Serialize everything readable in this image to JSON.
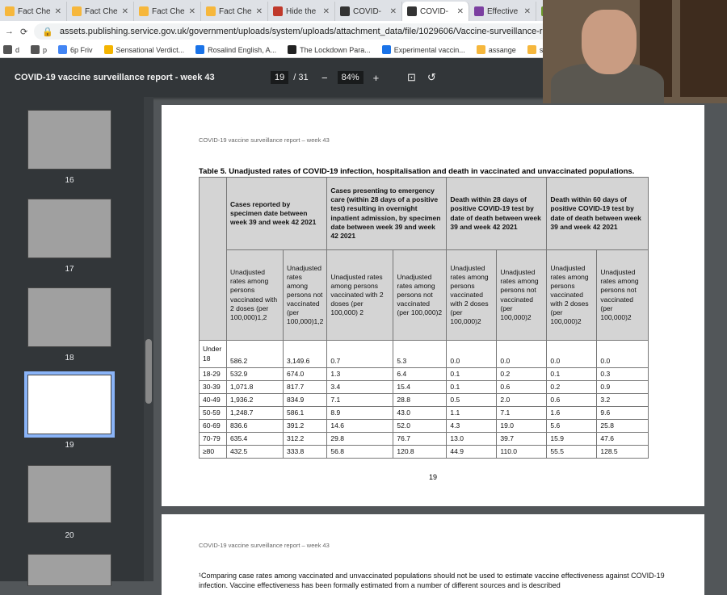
{
  "tabs": [
    {
      "label": "Fact Che",
      "color": "#f6b73c"
    },
    {
      "label": "Fact Che",
      "color": "#f6b73c"
    },
    {
      "label": "Fact Che",
      "color": "#f6b73c"
    },
    {
      "label": "Fact Che",
      "color": "#f6b73c"
    },
    {
      "label": "Hide the",
      "color": "#c0392b"
    },
    {
      "label": "COVID-",
      "color": "#333333"
    },
    {
      "label": "COVID-",
      "color": "#333333",
      "active": true
    },
    {
      "label": "Effective",
      "color": "#7b3fa0"
    },
    {
      "label": "CO",
      "color": "#6a9a2a"
    }
  ],
  "address": {
    "url": "assets.publishing.service.gov.uk/government/uploads/system/uploads/attachment_data/file/1029606/Vaccine-surveillance-repo..."
  },
  "bookmarks": [
    "d",
    "p",
    "6p Friv",
    "Sensational Verdict...",
    "Rosalind English, A...",
    "The Lockdown Para...",
    "Experimental vaccin...",
    "assange",
    "show wednesday"
  ],
  "viewer": {
    "title": "COVID-19 vaccine surveillance report - week 43",
    "page_current": "19",
    "page_total": "/ 31",
    "zoom": "84%"
  },
  "thumbnails": [
    {
      "number": "16"
    },
    {
      "number": "17"
    },
    {
      "number": "18"
    },
    {
      "number": "19",
      "selected": true
    },
    {
      "number": "20"
    }
  ],
  "page": {
    "running_head": "COVID-19 vaccine surveillance report – week 43",
    "caption": "Table 5. Unadjusted rates of COVID-19 infection, hospitalisation and death in vaccinated and unvaccinated populations.",
    "group_headers": [
      "Cases reported by specimen date between week 39 and week 42 2021",
      "Cases presenting to emergency care (within 28 days of a positive test) resulting in overnight inpatient admission, by specimen date between week 39 and week 42 2021",
      "Death within 28 days of positive COVID-19 test by date of death between week 39 and week 42 2021",
      "Death within 60 days of positive COVID-19 test by date of death between week 39 and week 42 2021"
    ],
    "sub_headers": [
      "Unadjusted rates among persons vaccinated with 2 doses (per 100,000)1,2",
      "Unadjusted rates among persons not vaccinated (per 100,000)1,2",
      "Unadjusted rates among persons vaccinated with 2 doses (per 100,000) 2",
      "Unadjusted rates among persons not vaccinated (per 100,000)2",
      "Unadjusted rates among persons vaccinated with 2 doses (per 100,000)2",
      "Unadjusted rates among persons not vaccinated (per 100,000)2",
      "Unadjusted rates among persons vaccinated with 2 doses (per 100,000)2",
      "Unadjusted rates among persons not vaccinated (per 100,000)2"
    ],
    "rows": [
      {
        "age": "Under 18",
        "values": [
          "586.2",
          "3,149.6",
          "0.7",
          "5.3",
          "0.0",
          "0.0",
          "0.0",
          "0.0"
        ]
      },
      {
        "age": "18-29",
        "values": [
          "532.9",
          "674.0",
          "1.3",
          "6.4",
          "0.1",
          "0.2",
          "0.1",
          "0.3"
        ]
      },
      {
        "age": "30-39",
        "values": [
          "1,071.8",
          "817.7",
          "3.4",
          "15.4",
          "0.1",
          "0.6",
          "0.2",
          "0.9"
        ]
      },
      {
        "age": "40-49",
        "values": [
          "1,936.2",
          "834.9",
          "7.1",
          "28.8",
          "0.5",
          "2.0",
          "0.6",
          "3.2"
        ]
      },
      {
        "age": "50-59",
        "values": [
          "1,248.7",
          "586.1",
          "8.9",
          "43.0",
          "1.1",
          "7.1",
          "1.6",
          "9.6"
        ]
      },
      {
        "age": "60-69",
        "values": [
          "836.6",
          "391.2",
          "14.6",
          "52.0",
          "4.3",
          "19.0",
          "5.6",
          "25.8"
        ]
      },
      {
        "age": "70-79",
        "values": [
          "635.4",
          "312.2",
          "29.8",
          "76.7",
          "13.0",
          "39.7",
          "15.9",
          "47.6"
        ]
      },
      {
        "age": "≥80",
        "values": [
          "432.5",
          "333.8",
          "56.8",
          "120.8",
          "44.9",
          "110.0",
          "55.5",
          "128.5"
        ]
      }
    ],
    "page_number": "19"
  },
  "next_page": {
    "running_head": "COVID-19 vaccine surveillance report – week 43",
    "footnote": "¹Comparing case rates among vaccinated and unvaccinated populations should not be used to estimate vaccine effectiveness against COVID-19 infection. Vaccine effectiveness has been formally estimated from a number of different sources and is described"
  }
}
